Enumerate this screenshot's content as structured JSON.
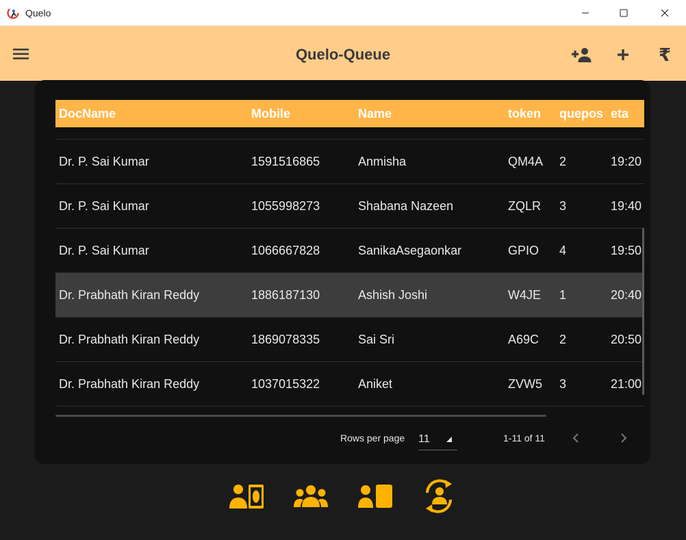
{
  "window": {
    "title": "Quelo"
  },
  "appbar": {
    "title": "Quelo-Queue",
    "rupee_glyph": "₹"
  },
  "table": {
    "columns": [
      "DocName",
      "Mobile",
      "Name",
      "token",
      "quepos",
      "eta"
    ],
    "rows": [
      {
        "doc": "Dr. P. Sai  Kumar",
        "mobile": "1591516865",
        "name": "Anmisha",
        "token": "QM4A",
        "quepos": "2",
        "eta": "19:20",
        "selected": false
      },
      {
        "doc": "Dr. P. Sai  Kumar",
        "mobile": "1055998273",
        "name": "Shabana Nazeen",
        "token": "ZQLR",
        "quepos": "3",
        "eta": "19:40",
        "selected": false
      },
      {
        "doc": "Dr. P. Sai  Kumar",
        "mobile": "1066667828",
        "name": "SanikaAsegaonkar",
        "token": "GPIO",
        "quepos": "4",
        "eta": "19:50",
        "selected": false
      },
      {
        "doc": "Dr. Prabhath Kiran Reddy",
        "mobile": "1886187130",
        "name": "Ashish Joshi",
        "token": "W4JE",
        "quepos": "1",
        "eta": "20:40",
        "selected": true
      },
      {
        "doc": "Dr. Prabhath Kiran Reddy",
        "mobile": "1869078335",
        "name": "Sai Sri",
        "token": "A69C",
        "quepos": "2",
        "eta": "20:50",
        "selected": false
      },
      {
        "doc": "Dr. Prabhath Kiran Reddy",
        "mobile": "1037015322",
        "name": "Aniket",
        "token": "ZVW5",
        "quepos": "3",
        "eta": "21:00",
        "selected": false
      }
    ]
  },
  "pagination": {
    "rows_per_page_label": "Rows per page",
    "rows_per_page": "11",
    "range": "1-11 of 11"
  },
  "colors": {
    "accent": "#ffb547",
    "appbar": "#ffcc8a",
    "nav_icon": "#ffb300",
    "selected_row": "#3d3d3d"
  },
  "icons": {
    "titlebar": [
      "app-logo-icon",
      "minimize-icon",
      "maximize-icon",
      "close-icon"
    ],
    "appbar": [
      "menu-icon",
      "add-person-icon",
      "plus-icon",
      "rupee-icon"
    ],
    "pager": [
      "chevron-left-icon",
      "chevron-right-icon"
    ],
    "bottom_nav": [
      "person-payment-icon",
      "group-icon",
      "person-card-icon",
      "person-sync-icon"
    ]
  }
}
